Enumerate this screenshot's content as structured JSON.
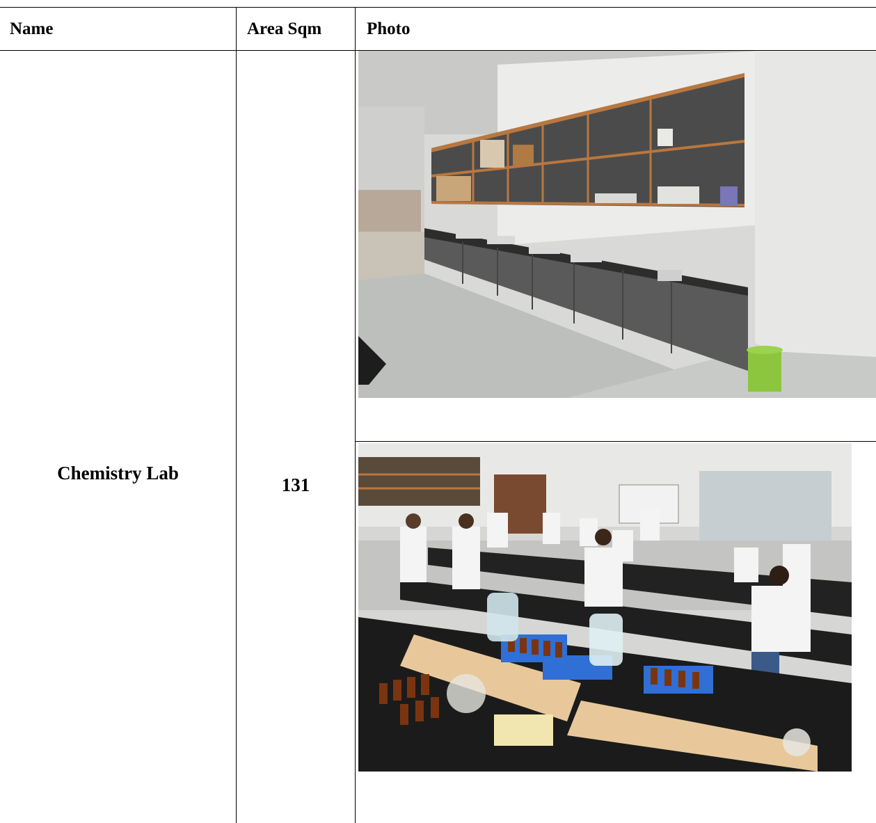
{
  "table": {
    "headers": {
      "name": "Name",
      "area": "Area Sqm",
      "photo": "Photo"
    },
    "rows": [
      {
        "name": "Chemistry Lab",
        "area": "131",
        "photos": [
          {
            "description_icon": "lab-cabinets-photo"
          },
          {
            "description_icon": "students-in-lab-photo"
          }
        ]
      }
    ]
  }
}
